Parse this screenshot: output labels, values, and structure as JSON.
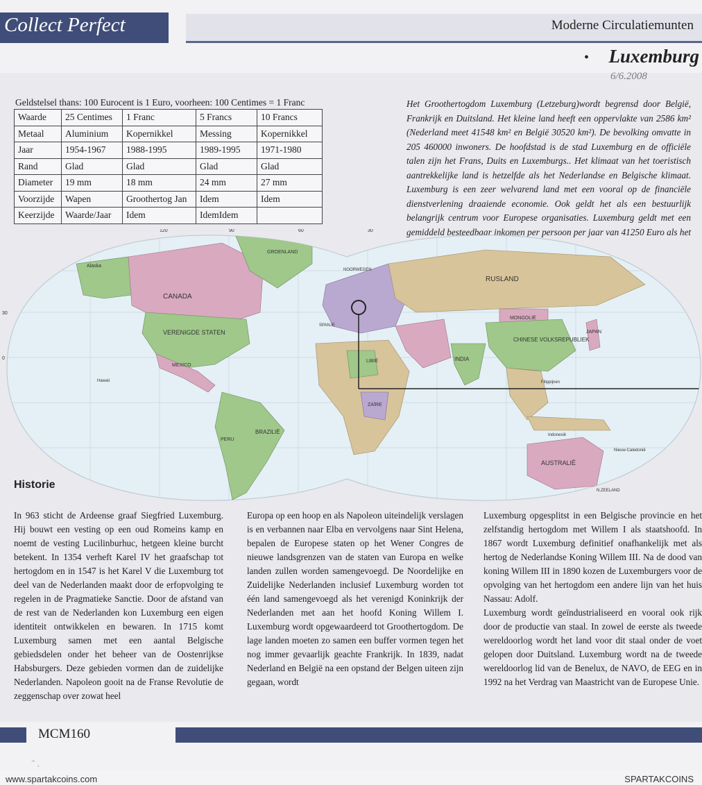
{
  "header": {
    "brand": "Collect Perfect",
    "section": "Moderne Circulatiemunten",
    "country": "Luxemburg",
    "bullet": "•",
    "handwritten_date": "6/6.2008"
  },
  "coin_table": {
    "caption": "Geldstelsel thans: 100 Eurocent is 1 Euro, voorheen: 100 Centimes = 1 Franc",
    "rows": [
      [
        "Waarde",
        "25 Centimes",
        "1 Franc",
        "5 Francs",
        "10 Francs"
      ],
      [
        "Metaal",
        "Aluminium",
        "Kopernikkel",
        "Messing",
        "Kopernikkel"
      ],
      [
        "Jaar",
        "1954-1967",
        "1988-1995",
        "1989-1995",
        "1971-1980"
      ],
      [
        "Rand",
        "Glad",
        "Glad",
        "Glad",
        "Glad"
      ],
      [
        "Diameter",
        "19 mm",
        " 18 mm",
        "24 mm",
        "27 mm"
      ],
      [
        "Voorzijde",
        "Wapen",
        "Groothertog Jan",
        "Idem",
        "Idem"
      ],
      [
        "Keerzijde",
        "Waarde/Jaar",
        "Idem",
        "IdemIdem",
        ""
      ]
    ]
  },
  "intro": "Het Groothertogdom Luxemburg (Letzeburg)wordt begrensd door België, Frankrijk en Duitsland. Het kleine land heeft een oppervlakte van 2586 km² (Nederland meet 41548 km² en België 30520 km²). De bevolking omvatte in 205 460000 inwoners. De hoofdstad is de stad Luxemburg en de officiële talen zijn het Frans, Duits en Luxemburgs.. Het klimaat van het toeristisch aantrekkelijke land is hetzelfde als het Nederlandse en Belgische klimaat. Luxemburg is een zeer welvarend land met een vooral op de financiële dienstverlening draaiende economie. Ook geldt het als een bestuurlijk belangrijk centrum voor Europese organisaties. Luxemburg geldt met een gemiddeld besteedbaar inkomen per persoon per jaar van 41250 Euro als het rijkste land ter wereld.",
  "map": {
    "labels": [
      "CANADA",
      "VERENIGDE STATEN",
      "MEXICO",
      "GROENLAND",
      "RUSLAND",
      "CHINESE VOLKSREPUBLIEK",
      "MONGOLIË",
      "INDIA",
      "JAPAN",
      "LIBIË",
      "ZAÏRE",
      "BRAZILIË",
      "PERU",
      "AUSTRALIË",
      "Alaska",
      "Hawaii",
      "Filippijnen",
      "NOORWEGEN",
      "SPANJE",
      "Indonesië",
      "Nieuw-Caledonië",
      "N.ZEELAND"
    ],
    "grid_labels": [
      "120",
      "90",
      "60",
      "30",
      "0",
      "30"
    ]
  },
  "history": {
    "heading": "Historie",
    "col1": "In 963 sticht de Ardeense graaf Siegfried Luxemburg. Hij bouwt een vesting op een oud Romeins kamp en noemt de vesting Lucilinburhuc, hetgeen kleine burcht betekent. In 1354 verheft Karel IV het graafschap tot hertogdom en in 1547 is het Karel V die Luxemburg tot deel van de Nederlanden maakt door de erfopvolging te regelen in de Pragmatieke Sanctie. Door de afstand van de rest van de Nederlanden kon Luxemburg een eigen identiteit ontwikkelen en bewaren. In 1715 komt Luxemburg samen met een aantal Belgische gebiedsdelen onder het beheer van de Oostenrijkse Habsburgers. Deze gebieden vormen dan de zuidelijke Nederlanden. Napoleon gooit na de Franse Revolutie de zeggenschap over zowat heel",
    "col2": "Europa op een hoop en als Napoleon uiteindelijk verslagen is en verbannen naar Elba en vervolgens naar Sint Helena, bepalen de Europese staten op het Wener Congres de nieuwe landsgrenzen van de staten van Europa en welke landen zullen worden samengevoegd. De Noordelijke en Zuidelijke Nederlanden inclusief Luxemburg worden tot één land samengevoegd als het verenigd Koninkrijk der Nederlanden met aan het hoofd Koning Willem I. Luxemburg wordt opgewaardeerd tot Groothertogdom. De lage landen moeten zo samen een buffer vormen tegen het nog immer gevaarlijk geachte Frankrijk. In 1839, nadat Nederland en België na een opstand der Belgen uiteen zijn gegaan, wordt",
    "col3a": "Luxemburg opgesplitst in een Belgische provincie en het zelfstandig hertogdom met Willem I als staatshoofd. In 1867 wordt Luxemburg definitief onafhankelijk met als hertog de Nederlandse Koning Willem III. Na de dood van koning Willem III in 1890 kozen de Luxemburgers voor de opvolging van het hertogdom een andere lijn van het huis Nassau: Adolf.",
    "col3b": "Luxemburg wordt geïndustrialiseerd en vooral ook rijk door de productie van staal. In zowel de eerste als tweede wereldoorlog wordt het land voor dit staal onder de voet gelopen door Duitsland. Luxemburg wordt na de tweede wereldoorlog lid van de Benelux, de NAVO, de EEG en in 1992 na het Verdrag van Maastricht van de Europese Unie."
  },
  "footer": {
    "code": "MCM160"
  },
  "watermark": {
    "left": "www.spartakcoins.com",
    "right": "SPARTAKCOINS"
  },
  "colors": {
    "brand_blue": "#3f4d78",
    "ocean": "#e4f0f5",
    "land_pink": "#d9a9bf",
    "land_green": "#9fc88a",
    "land_tan": "#d8c49a",
    "land_purple": "#b9a8cf"
  }
}
